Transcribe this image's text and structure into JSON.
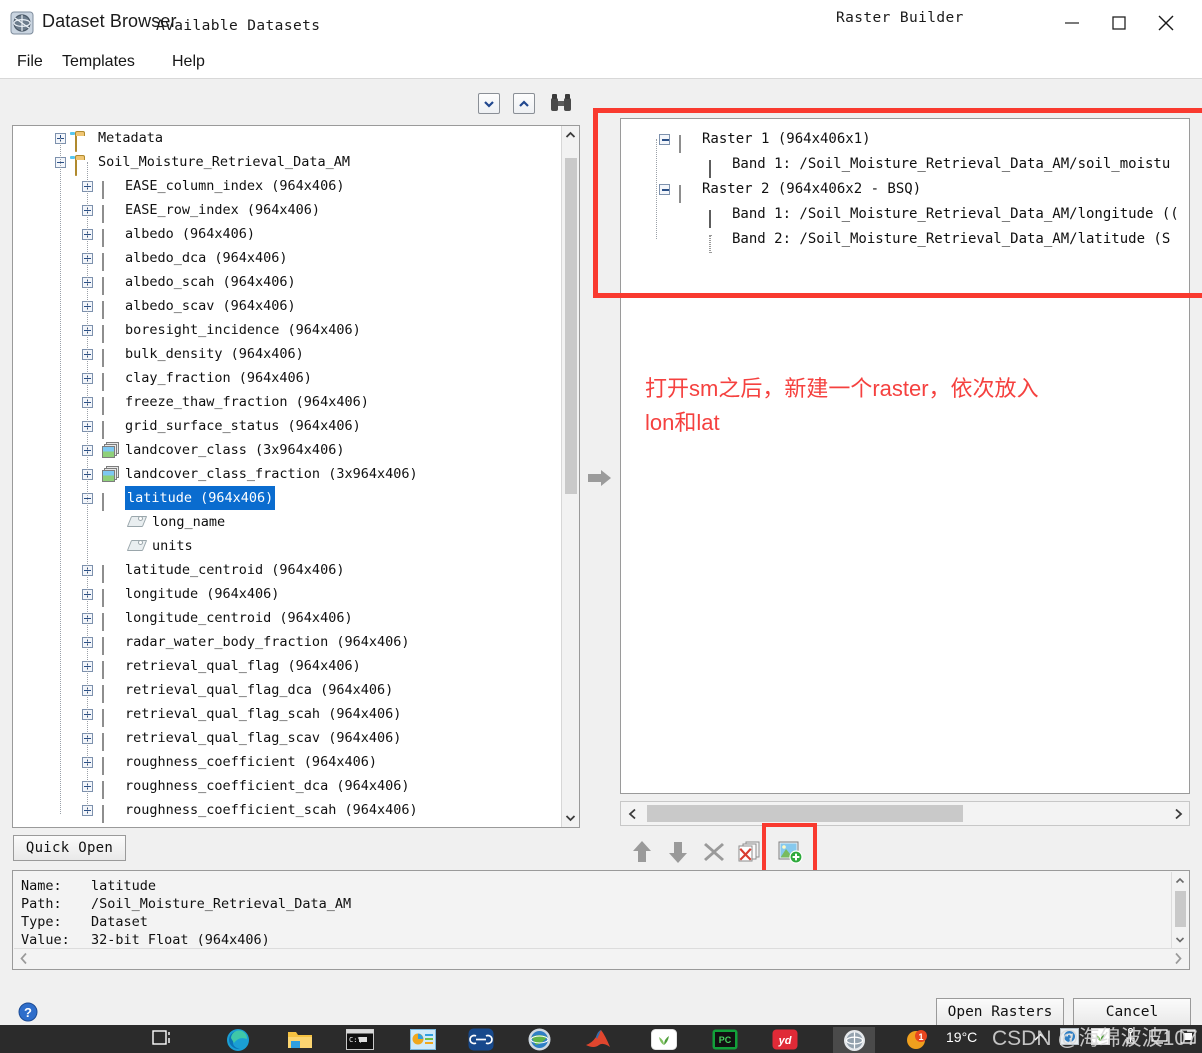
{
  "window": {
    "title": "Dataset Browser",
    "icon": "envi-globe-icon",
    "minimize": "–",
    "maximize": "□",
    "close": "✕"
  },
  "menubar": {
    "items": [
      {
        "label": "File"
      },
      {
        "label": "Templates"
      },
      {
        "label": "Help"
      }
    ]
  },
  "available_panel": {
    "heading": "Available Datasets",
    "toolbar": [
      {
        "name": "collapse-all-icon",
        "glyph": "▾"
      },
      {
        "name": "expand-all-icon",
        "glyph": "▴"
      },
      {
        "name": "find-icon",
        "glyph": "binoculars"
      }
    ],
    "tree": [
      {
        "indent": 0,
        "state": "plus",
        "icon": "folder",
        "label": "Metadata"
      },
      {
        "indent": 0,
        "state": "minus",
        "icon": "folder",
        "label": "Soil_Moisture_Retrieval_Data_AM"
      },
      {
        "indent": 1,
        "state": "plus",
        "icon": "raster",
        "label": "EASE_column_index (964x406)"
      },
      {
        "indent": 1,
        "state": "plus",
        "icon": "raster",
        "label": "EASE_row_index (964x406)"
      },
      {
        "indent": 1,
        "state": "plus",
        "icon": "raster",
        "label": "albedo (964x406)"
      },
      {
        "indent": 1,
        "state": "plus",
        "icon": "raster",
        "label": "albedo_dca (964x406)"
      },
      {
        "indent": 1,
        "state": "plus",
        "icon": "raster",
        "label": "albedo_scah (964x406)"
      },
      {
        "indent": 1,
        "state": "plus",
        "icon": "raster",
        "label": "albedo_scav (964x406)"
      },
      {
        "indent": 1,
        "state": "plus",
        "icon": "raster",
        "label": "boresight_incidence (964x406)"
      },
      {
        "indent": 1,
        "state": "plus",
        "icon": "raster",
        "label": "bulk_density (964x406)"
      },
      {
        "indent": 1,
        "state": "plus",
        "icon": "raster",
        "label": "clay_fraction (964x406)"
      },
      {
        "indent": 1,
        "state": "plus",
        "icon": "raster",
        "label": "freeze_thaw_fraction (964x406)"
      },
      {
        "indent": 1,
        "state": "plus",
        "icon": "raster",
        "label": "grid_surface_status (964x406)"
      },
      {
        "indent": 1,
        "state": "plus",
        "icon": "image",
        "label": "landcover_class (3x964x406)"
      },
      {
        "indent": 1,
        "state": "plus",
        "icon": "image",
        "label": "landcover_class_fraction (3x964x406)"
      },
      {
        "indent": 1,
        "state": "minus",
        "icon": "raster",
        "label": "latitude (964x406)",
        "selected": true
      },
      {
        "indent": 2,
        "state": "none",
        "icon": "tag",
        "label": "long_name"
      },
      {
        "indent": 2,
        "state": "none",
        "icon": "tag",
        "label": "units"
      },
      {
        "indent": 1,
        "state": "plus",
        "icon": "raster",
        "label": "latitude_centroid (964x406)"
      },
      {
        "indent": 1,
        "state": "plus",
        "icon": "raster",
        "label": "longitude (964x406)"
      },
      {
        "indent": 1,
        "state": "plus",
        "icon": "raster",
        "label": "longitude_centroid (964x406)"
      },
      {
        "indent": 1,
        "state": "plus",
        "icon": "raster",
        "label": "radar_water_body_fraction (964x406)"
      },
      {
        "indent": 1,
        "state": "plus",
        "icon": "raster",
        "label": "retrieval_qual_flag (964x406)"
      },
      {
        "indent": 1,
        "state": "plus",
        "icon": "raster",
        "label": "retrieval_qual_flag_dca (964x406)"
      },
      {
        "indent": 1,
        "state": "plus",
        "icon": "raster",
        "label": "retrieval_qual_flag_scah (964x406)"
      },
      {
        "indent": 1,
        "state": "plus",
        "icon": "raster",
        "label": "retrieval_qual_flag_scav (964x406)"
      },
      {
        "indent": 1,
        "state": "plus",
        "icon": "raster",
        "label": "roughness_coefficient (964x406)"
      },
      {
        "indent": 1,
        "state": "plus",
        "icon": "raster",
        "label": "roughness_coefficient_dca (964x406)"
      },
      {
        "indent": 1,
        "state": "plus",
        "icon": "raster",
        "label": "roughness_coefficient_scah (964x406)"
      }
    ],
    "quick_open_label": "Quick Open"
  },
  "raster_builder": {
    "heading": "Raster Builder",
    "tree": [
      {
        "indent": 0,
        "state": "minus",
        "icon": "raster",
        "label": "Raster 1 (964x406x1)"
      },
      {
        "indent": 1,
        "state": "none",
        "icon": "band",
        "label": "Band 1: /Soil_Moisture_Retrieval_Data_AM/soil_moistu"
      },
      {
        "indent": 0,
        "state": "minus",
        "icon": "raster",
        "label": "Raster 2 (964x406x2 - BSQ)"
      },
      {
        "indent": 1,
        "state": "none",
        "icon": "band",
        "label": "Band 1: /Soil_Moisture_Retrieval_Data_AM/longitude (("
      },
      {
        "indent": 1,
        "state": "none",
        "icon": "band-empty",
        "label": "Band 2: /Soil_Moisture_Retrieval_Data_AM/latitude (S"
      }
    ],
    "toolbar": [
      {
        "name": "move-up-button",
        "glyph": "↑"
      },
      {
        "name": "move-down-button",
        "glyph": "↓"
      },
      {
        "name": "remove-button",
        "glyph": "✕"
      },
      {
        "name": "remove-all-button",
        "glyph": "✕▧"
      },
      {
        "name": "new-raster-button",
        "glyph": "new-raster"
      }
    ]
  },
  "annotation": {
    "line1": "打开sm之后，新建一个raster，依次放入",
    "line2": "lon和lat",
    "color": "#f5413f"
  },
  "info_panel": {
    "rows": [
      {
        "key": "Name:",
        "value": "latitude"
      },
      {
        "key": "Path:",
        "value": "/Soil_Moisture_Retrieval_Data_AM"
      },
      {
        "key": "Type:",
        "value": "Dataset"
      },
      {
        "key": "Value:",
        "value": "32-bit Float (964x406)"
      }
    ]
  },
  "footer": {
    "help_icon": "help-question-icon",
    "open_rasters_label": "Open Rasters",
    "cancel_label": "Cancel"
  },
  "taskbar": {
    "temperature": "19°C",
    "badge_count": "1",
    "watermark": "CSDN @海绵波波107"
  },
  "highlights": {
    "raster_list_box_color": "#f93a2f",
    "new_raster_box_color": "#f93a2f"
  }
}
